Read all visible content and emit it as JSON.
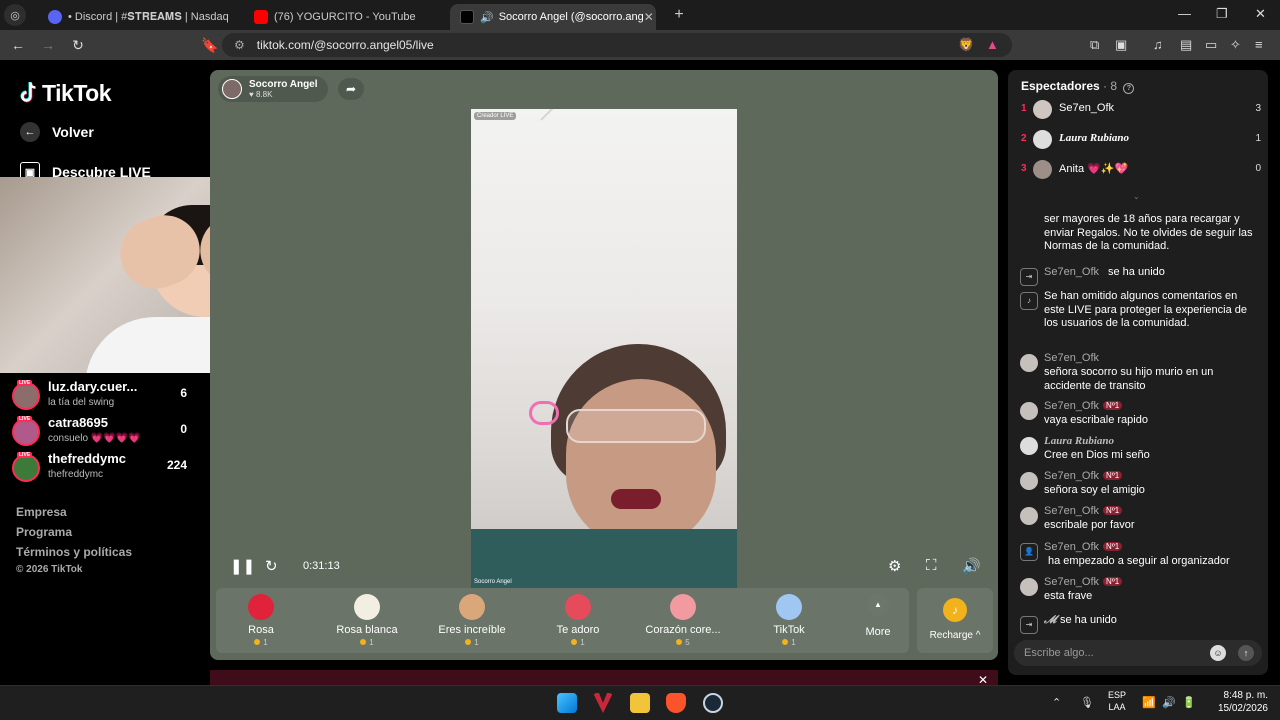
{
  "tabs": [
    {
      "label": "• Discord | #𝐒𝐓𝐑𝐄𝐀𝐌𝐒 | Nasdaq",
      "favicon_color": "#5865f2"
    },
    {
      "label": "(76) YOGURCITO - YouTube",
      "favicon_color": "#ff0000"
    },
    {
      "label": "Socorro Angel (@socorro.ang",
      "favicon_color": "#000000"
    }
  ],
  "url": "tiktok.com/@socorro.angel05/live",
  "tiktok": {
    "logo": "TikTok",
    "back_label": "Volver",
    "discover_label": "Descubre LIVE",
    "following": [
      {
        "name": "luz.dary.cuer...",
        "sub": "la tía del swing",
        "count": "6"
      },
      {
        "name": "catra8695",
        "sub": "consuelo 💗💗💗💗",
        "count": "0"
      },
      {
        "name": "thefreddymc",
        "sub": "thefreddymc",
        "count": "224"
      }
    ],
    "footer": [
      "Empresa",
      "Programa",
      "Términos y políticas",
      "© 2026 TikTok"
    ]
  },
  "player": {
    "host_name": "Socorro Angel",
    "host_likes": "8.8K",
    "creator_badge": "Creador LIVE",
    "video_name": "Socorro Angel",
    "time": "0:31:13"
  },
  "gifts": [
    {
      "name": "Rosa",
      "price": "1",
      "color": "#e0223a"
    },
    {
      "name": "Rosa blanca",
      "price": "1",
      "color": "#f2efe2"
    },
    {
      "name": "Eres increíble",
      "price": "1",
      "color": "#d9a77a"
    },
    {
      "name": "Te adoro",
      "price": "1",
      "color": "#e54b5a"
    },
    {
      "name": "Corazón core...",
      "price": "5",
      "color": "#f19aa0"
    },
    {
      "name": "TikTok",
      "price": "1",
      "color": "#9fc7f2"
    }
  ],
  "more_label": "More",
  "recharge_label": "Recharge ^",
  "viewers": {
    "title": "Espectadores",
    "count": "· 8",
    "list": [
      {
        "rank": "1",
        "name": "Se7en_Ofk",
        "score": "3"
      },
      {
        "rank": "2",
        "name": "Laura Rubiano",
        "score": "1"
      },
      {
        "rank": "3",
        "name": "Anita 💗✨💖",
        "score": "0"
      }
    ]
  },
  "chat": {
    "system_top": "ser mayores de 18 años para recargar y enviar Regalos. No te olvides de seguir las Normas de la comunidad.",
    "joined1_user": "Se7en_Ofk",
    "joined1_text": "se ha unido",
    "omitted": "Se han omitido algunos comentarios en este LIVE para proteger la experiencia de los usuarios de la comunidad.",
    "m1_user": "Se7en_Ofk",
    "m1_text": "señora socorro su hijo murio en un accidente de transito",
    "m2_user": "Se7en_Ofk",
    "m2_badge": "Nº1",
    "m2_text": "vaya escribale rapido",
    "m3_user": "Laura Rubiano",
    "m3_text": "Cree en Dios mi seño",
    "m4_user": "Se7en_Ofk",
    "m4_badge": "Nº1",
    "m4_text": "señora soy el amigio",
    "m5_user": "Se7en_Ofk",
    "m5_badge": "Nº1",
    "m5_text": "escribale por favor",
    "m6_user": "Se7en_Ofk",
    "m6_badge": "Nº1",
    "m6_text": "ha empezado a seguir al organizador",
    "m7_user": "Se7en_Ofk",
    "m7_badge": "Nº1",
    "m7_text": "esta frave",
    "joined2_user": "𝓜",
    "joined2_text": "se ha unido",
    "input_placeholder": "Escribe algo..."
  },
  "taskbar": {
    "lang1": "ESP",
    "lang2": "LAA",
    "time": "8:48 p. m.",
    "date": "15/02/2026"
  }
}
